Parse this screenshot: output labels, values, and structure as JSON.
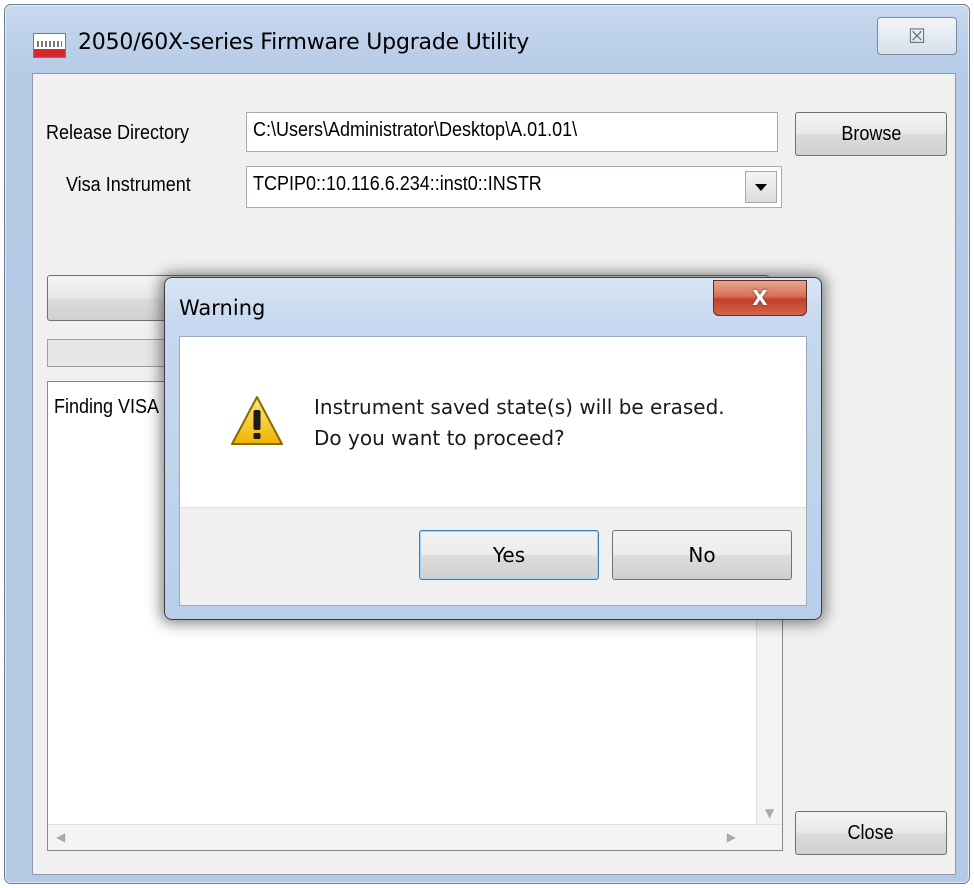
{
  "main_window": {
    "title": "2050/60X-series Firmware Upgrade Utility",
    "close_glyph": "☒",
    "release_directory": {
      "label": "Release Directory",
      "value": "C:\\Users\\Administrator\\Desktop\\A.01.01\\",
      "browse_label": "Browse"
    },
    "visa_instrument": {
      "label": "Visa Instrument",
      "selected": "TCPIP0::10.116.6.234::inst0::INSTR"
    },
    "log": {
      "text": "Finding VISA"
    },
    "close_label": "Close"
  },
  "dialog": {
    "title": "Warning",
    "close_glyph": "X",
    "icon": "warning-triangle-icon",
    "message_line1": "Instrument saved state(s) will be erased.",
    "message_line2": "Do you want to proceed?",
    "yes_label": "Yes",
    "no_label": "No"
  },
  "colors": {
    "window_frame": "#b9cfe9",
    "client_bg": "#f0f0f0",
    "close_button_red": "#c2412a",
    "warning_yellow": "#f4c21b"
  }
}
